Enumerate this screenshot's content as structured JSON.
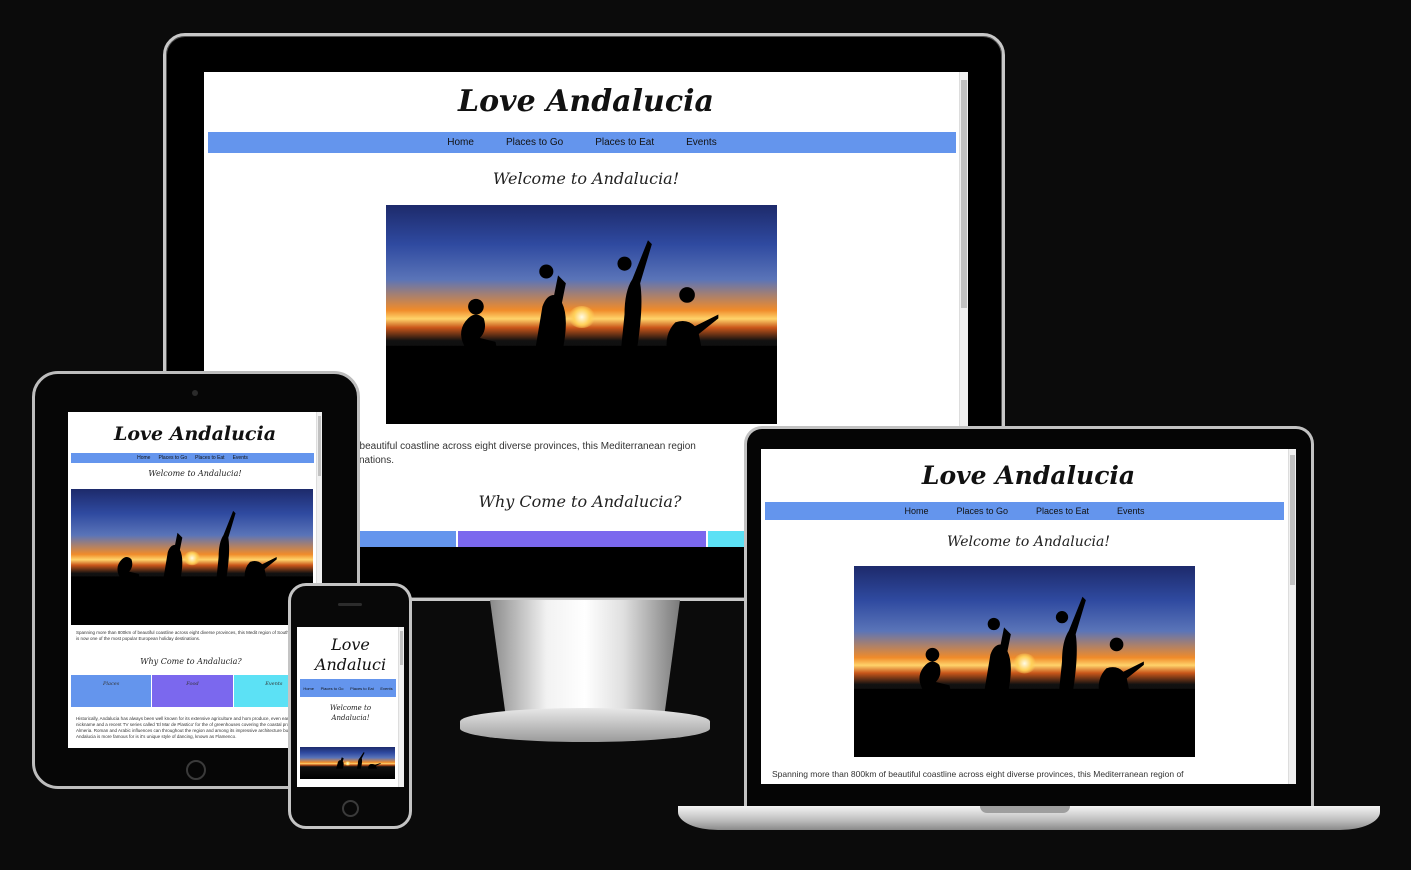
{
  "site": {
    "title": "Love Andalucia",
    "nav": [
      "Home",
      "Places to Go",
      "Places to Eat",
      "Events"
    ],
    "welcome": "Welcome to Andalucia!",
    "why_heading": "Why Come to Andalucia?",
    "intro_monitor_1": "f beautiful coastline across eight diverse provinces, this Mediterranean region",
    "intro_monitor_2": "tinations.",
    "intro_laptop": "Spanning more than 800km of beautiful coastline across eight diverse provinces, this Mediterranean region of",
    "intro_tablet": "Spanning more than 800km of beautiful coastline across eight diverse provinces, this Medit region of Southern Spain is now one of the most popular European holiday destinations.",
    "tiles": [
      "Places",
      "Food",
      "Events"
    ],
    "history_tablet": "Historically, Andalucia has always been well known for its extensive agriculture and hom produce, even earning the nickname and a recent TV series called 'El Mar de Plastico' for the of greenhouses covering the coastal province of Almeria. Roman and Arabic influences can throughout the region and among its impressive architecture but what Andalucia is more famous for is it's unique style of dancing, known as Flamenco."
  },
  "phone_title_1": "Love",
  "phone_title_2": "Andaluci",
  "phone_welcome_1": "Welcome to",
  "phone_welcome_2": "Andalucia!",
  "colors": {
    "nav_blue": "#6495ed",
    "tile_blue": "#6495ed",
    "tile_purple": "#7b68ee",
    "tile_cyan": "#5ce1f5"
  }
}
